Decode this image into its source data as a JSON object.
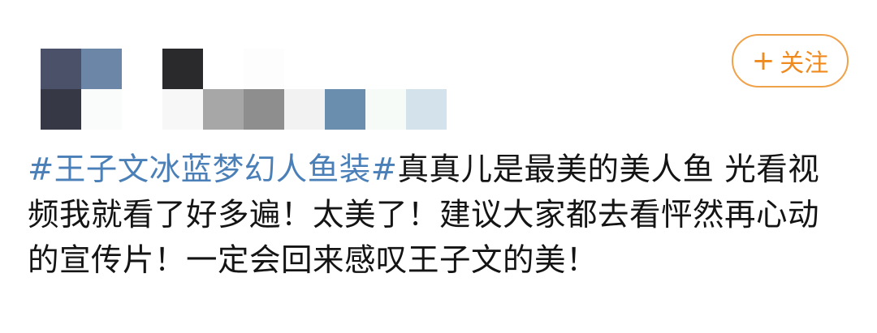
{
  "author": {
    "mosaic_colors": [
      "#4a5168",
      "#6c86a8",
      "#ffffff",
      "#2a2a2c",
      "#ffffff",
      "#fdfdfd",
      "#ffffff",
      "#ffffff",
      "#ffffff",
      "#ffffff",
      "#373846",
      "#fafcfb",
      "#ffffff",
      "#f7f7f7",
      "#a7a7a7",
      "#8e8e8e",
      "#f2f2f2",
      "#6a8ead",
      "#f6fbf8",
      "#d4e2ec"
    ]
  },
  "follow_button": {
    "icon": "plus-icon",
    "plus_glyph": "+",
    "label": "关注",
    "color": "#ef8a1f"
  },
  "post": {
    "hashtag": "#王子文冰蓝梦幻人鱼装#",
    "body": "真真儿是最美的美人鱼 光看视频我就看了好多遍！太美了！建议大家都去看怦然再心动的宣传片！一定会回来感叹王子文的美！",
    "hashtag_color": "#4a7fb8"
  }
}
